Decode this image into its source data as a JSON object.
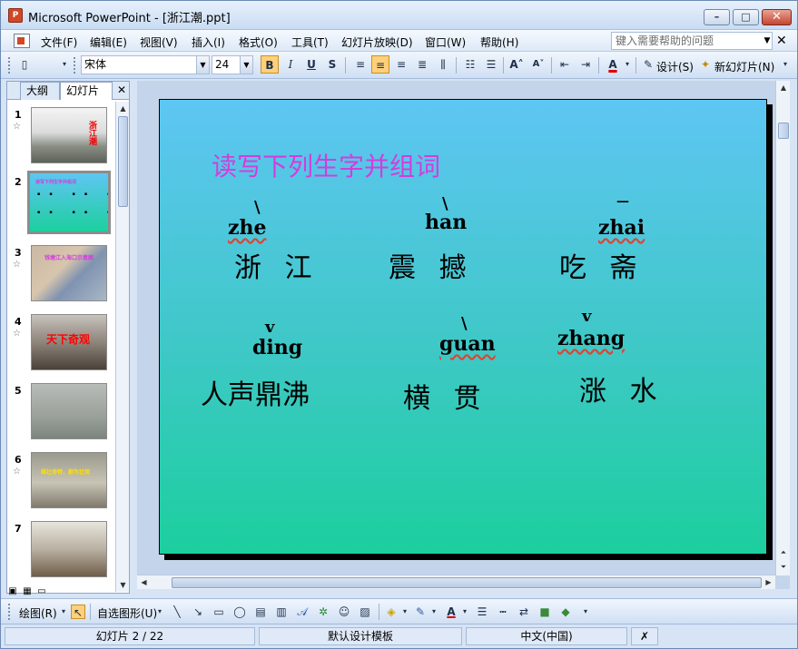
{
  "window": {
    "title": "Microsoft PowerPoint - [浙江潮.ppt]",
    "minimize": "–",
    "maximize": "□",
    "close": "✕"
  },
  "menu": {
    "items": [
      "文件(F)",
      "编辑(E)",
      "视图(V)",
      "插入(I)",
      "格式(O)",
      "工具(T)",
      "幻灯片放映(D)",
      "窗口(W)",
      "帮助(H)"
    ],
    "help_placeholder": "键入需要帮助的问题",
    "doc_close": "✕"
  },
  "toolbar": {
    "font_name": "宋体",
    "font_size": "24",
    "bold": "B",
    "italic": "I",
    "underline": "U",
    "shadow": "S",
    "design_label": "设计(S)",
    "new_slide_label": "新幻灯片(N)"
  },
  "left_pane": {
    "tab_outline": "大纲",
    "tab_slides": "幻灯片",
    "close": "✕",
    "thumbnails": [
      {
        "num": "1",
        "star": "☆",
        "text": "浙江潮"
      },
      {
        "num": "2",
        "star": "",
        "text": "读写下列生字并组词"
      },
      {
        "num": "3",
        "star": "☆",
        "text": "钱塘江入海口示意图"
      },
      {
        "num": "4",
        "star": "☆",
        "text": "天下奇观"
      },
      {
        "num": "5",
        "star": "",
        "text": ""
      },
      {
        "num": "6",
        "star": "☆",
        "text": "雄壮奇特，蔚为壮观"
      },
      {
        "num": "7",
        "star": "",
        "text": ""
      }
    ]
  },
  "slide": {
    "title": "读写下列生字并组词",
    "row1": [
      {
        "pinyin": "zhe",
        "tone": "\\",
        "words": "浙 江"
      },
      {
        "pinyin": "han",
        "tone": "\\",
        "words": "震 撼"
      },
      {
        "pinyin": "zhai",
        "tone": "—",
        "words": "吃 斋"
      }
    ],
    "row2": [
      {
        "pinyin": "ding",
        "tone": "v",
        "words": "人声鼎沸"
      },
      {
        "pinyin": "guan",
        "tone": "\\",
        "words": "横 贯"
      },
      {
        "pinyin": "zhang",
        "tone": "v",
        "words": "涨 水"
      }
    ]
  },
  "draw_toolbar": {
    "draw_label": "绘图(R)",
    "autoshapes_label": "自选图形(U)"
  },
  "status": {
    "slide_indicator": "幻灯片 2 / 22",
    "template": "默认设计模板",
    "language": "中文(中国)"
  },
  "colors": {
    "title_magenta": "#d43cdc",
    "close_red": "#c74432",
    "highlight": "#ffd07a"
  }
}
